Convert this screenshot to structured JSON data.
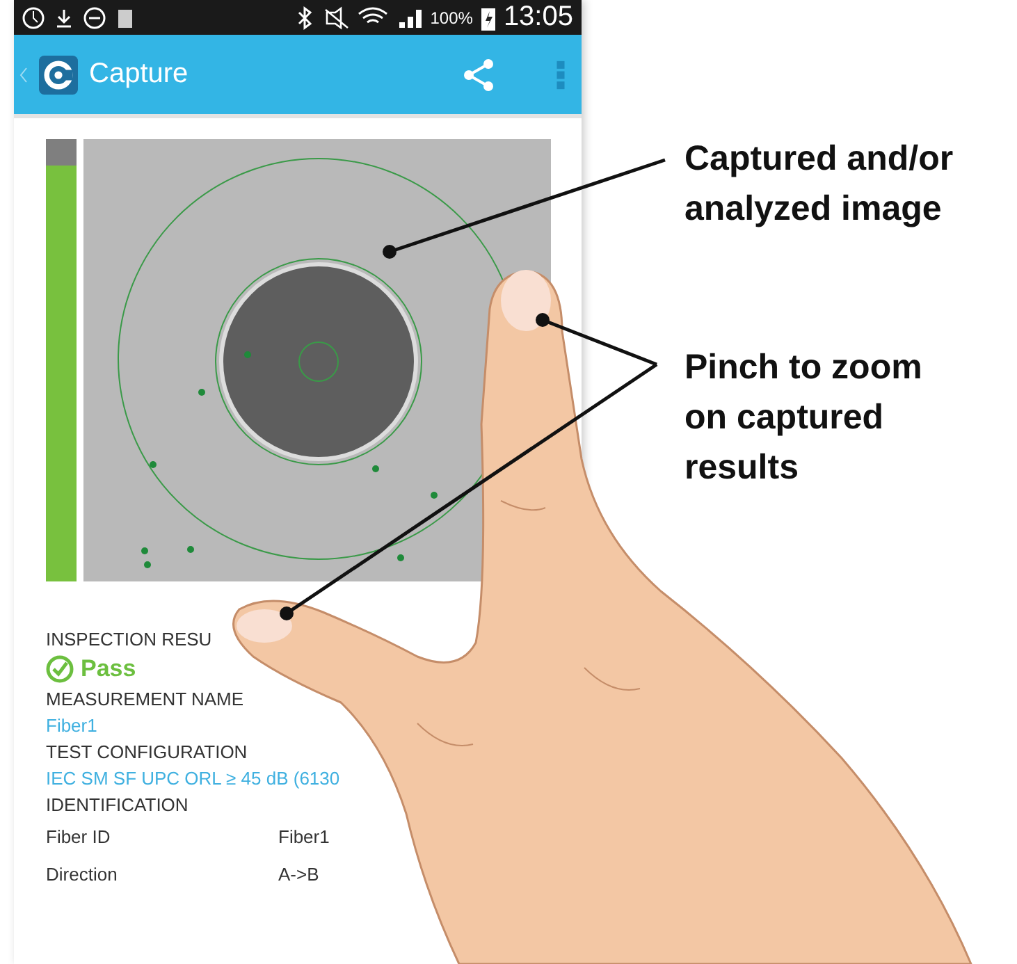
{
  "status_bar": {
    "battery": "100%",
    "time": "13:05"
  },
  "app_bar": {
    "title": "Capture"
  },
  "capture": {
    "signal_bar": {
      "level": 0.94
    }
  },
  "details": [
    {
      "kind": "label",
      "text": "INSPECTION RESU"
    },
    {
      "kind": "result",
      "text": "Pass"
    },
    {
      "kind": "label",
      "text": "MEASUREMENT NAME"
    },
    {
      "kind": "value",
      "text": "Fiber1"
    },
    {
      "kind": "label",
      "text": "TEST CONFIGURATION"
    },
    {
      "kind": "value",
      "text": "IEC SM SF UPC ORL ≥ 45 dB (6130"
    },
    {
      "kind": "label",
      "text": "IDENTIFICATION"
    },
    {
      "kind": "pair",
      "text": "Fiber ID",
      "value": "Fiber1"
    },
    {
      "kind": "pair",
      "text": "Direction",
      "value": "A->B"
    }
  ],
  "callouts": [
    {
      "text": "Captured and/or analyzed image"
    },
    {
      "text": "Pinch to zoom on captured results"
    }
  ]
}
